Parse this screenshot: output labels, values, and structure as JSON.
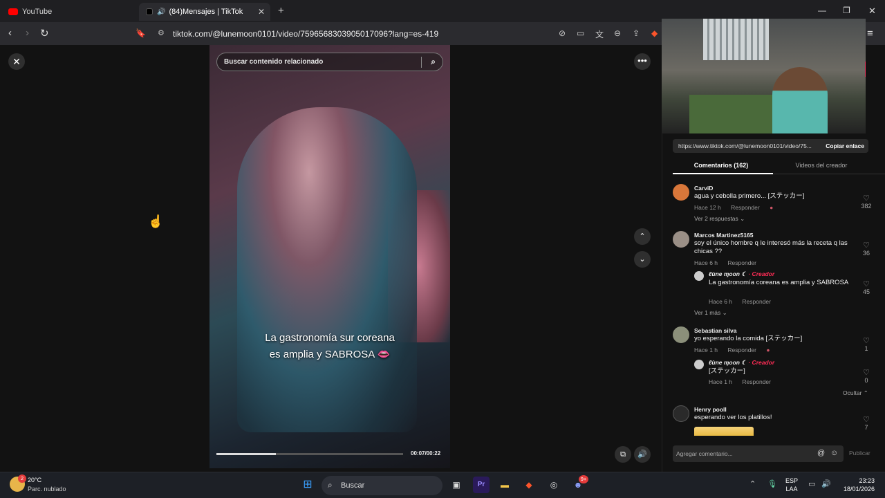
{
  "browser": {
    "tabs": [
      {
        "title": "YouTube",
        "favicon_color": "#ff0000"
      },
      {
        "title": "(84)Mensajes | TikTok",
        "favicon_color": "#000000",
        "audio_icon": "speaker-icon"
      }
    ],
    "url": "tiktok.com/@lunemoon0101/video/7596568303905017096?lang=es-419"
  },
  "video": {
    "search_placeholder": "Buscar contenido relacionado",
    "caption_line1": "La gastronomía sur coreana",
    "caption_line2": "es amplia y SABROSA 👄",
    "time": "00:07/00:22",
    "progress_fraction": 0.32
  },
  "panel": {
    "share_url": "https://www.tiktok.com/@lunemoon0101/video/75...",
    "copy_label": "Copiar enlace",
    "tabs": [
      "Comentarios (162)",
      "Videos del creador"
    ],
    "comments": [
      {
        "user": "CarviD",
        "text": "agua y cebolla primero... [ステッカー]",
        "time": "Hace 12 h",
        "reply": "Responder",
        "likes": "382",
        "more": "Ver 2 respuestas ⌄"
      },
      {
        "user": "Marcos Martinez5165",
        "text": "soy el único hombre q le interesó más la receta q las chicas ??",
        "time": "Hace 6 h",
        "reply": "Responder",
        "likes": "36"
      },
      {
        "user": "ℓùne ɱoon ☾",
        "badge": "· Creador",
        "text": "La gastronomía coreana es amplia y SABROSA",
        "time": "Hace 6 h",
        "reply": "Responder",
        "likes": "45",
        "more": "Ver 1 más ⌄"
      },
      {
        "user": "Sebastian silva",
        "text": "yo esperando la comida [ステッカー]",
        "time": "Hace 1 h",
        "reply": "Responder",
        "likes": "1"
      },
      {
        "user": "ℓùne ɱoon ☾",
        "badge": "· Creador",
        "text": "[ステッカー]",
        "time": "Hace 1 h",
        "reply": "Responder",
        "likes": "0",
        "more": "Ocultar ⌃"
      },
      {
        "user": "Henry pooll",
        "text": "esperando ver los platillos!",
        "likes": "7"
      }
    ],
    "input_placeholder": "Agregar comentario...",
    "publish_label": "Publicar"
  },
  "taskbar": {
    "temperature": "20°C",
    "weather": "Parc. nublado",
    "weather_badge": "2",
    "search_label": "Buscar",
    "discord_badge": "9+",
    "lang_line1": "ESP",
    "lang_line2": "LAA",
    "time": "23:23",
    "date": "18/01/2026"
  }
}
